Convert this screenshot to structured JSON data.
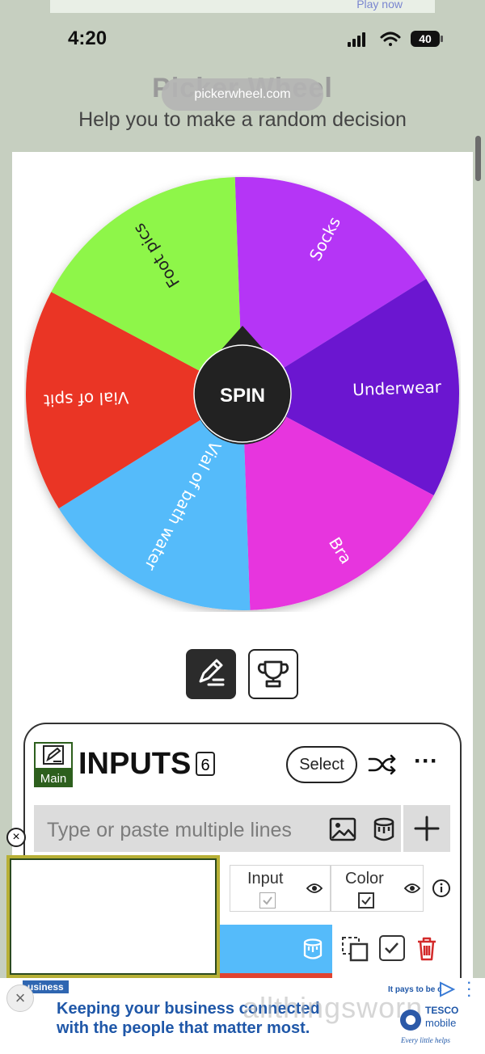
{
  "status_bar": {
    "time": "4:20",
    "battery": "40"
  },
  "top_ad": {
    "text": "Play now"
  },
  "header": {
    "title": "Picker Wheel",
    "url": "pickerwheel.com",
    "subtitle": "Help you to make a random decision"
  },
  "wheel": {
    "center_label": "SPIN",
    "segments": [
      {
        "label": "Socks",
        "color": "#b535f6"
      },
      {
        "label": "Underwear",
        "color": "#6b16d0"
      },
      {
        "label": "Bra",
        "color": "#e735de"
      },
      {
        "label": "Vial of bath water",
        "color": "#55bbfa"
      },
      {
        "label": "Vial of spit",
        "color": "#ea3525"
      },
      {
        "label": "Foot pics",
        "color": "#8ef649"
      }
    ]
  },
  "inputs": {
    "badge": "Main",
    "title": "INPUTS",
    "count": "6",
    "select_label": "Select",
    "placeholder": "Type or paste multiple lines",
    "columns": {
      "input": "Input",
      "color": "Color"
    }
  },
  "video": {
    "close": "×"
  },
  "bottom_ad": {
    "badge": "usiness",
    "line1": "Keeping your business connected",
    "line2": "with the people that matter most.",
    "tagline": "It pays to be c",
    "brand": "TESCO",
    "brand_sub": "mobile",
    "brand_slogan": "Every little helps",
    "watermark": "allthingsworn",
    "close": "×"
  }
}
